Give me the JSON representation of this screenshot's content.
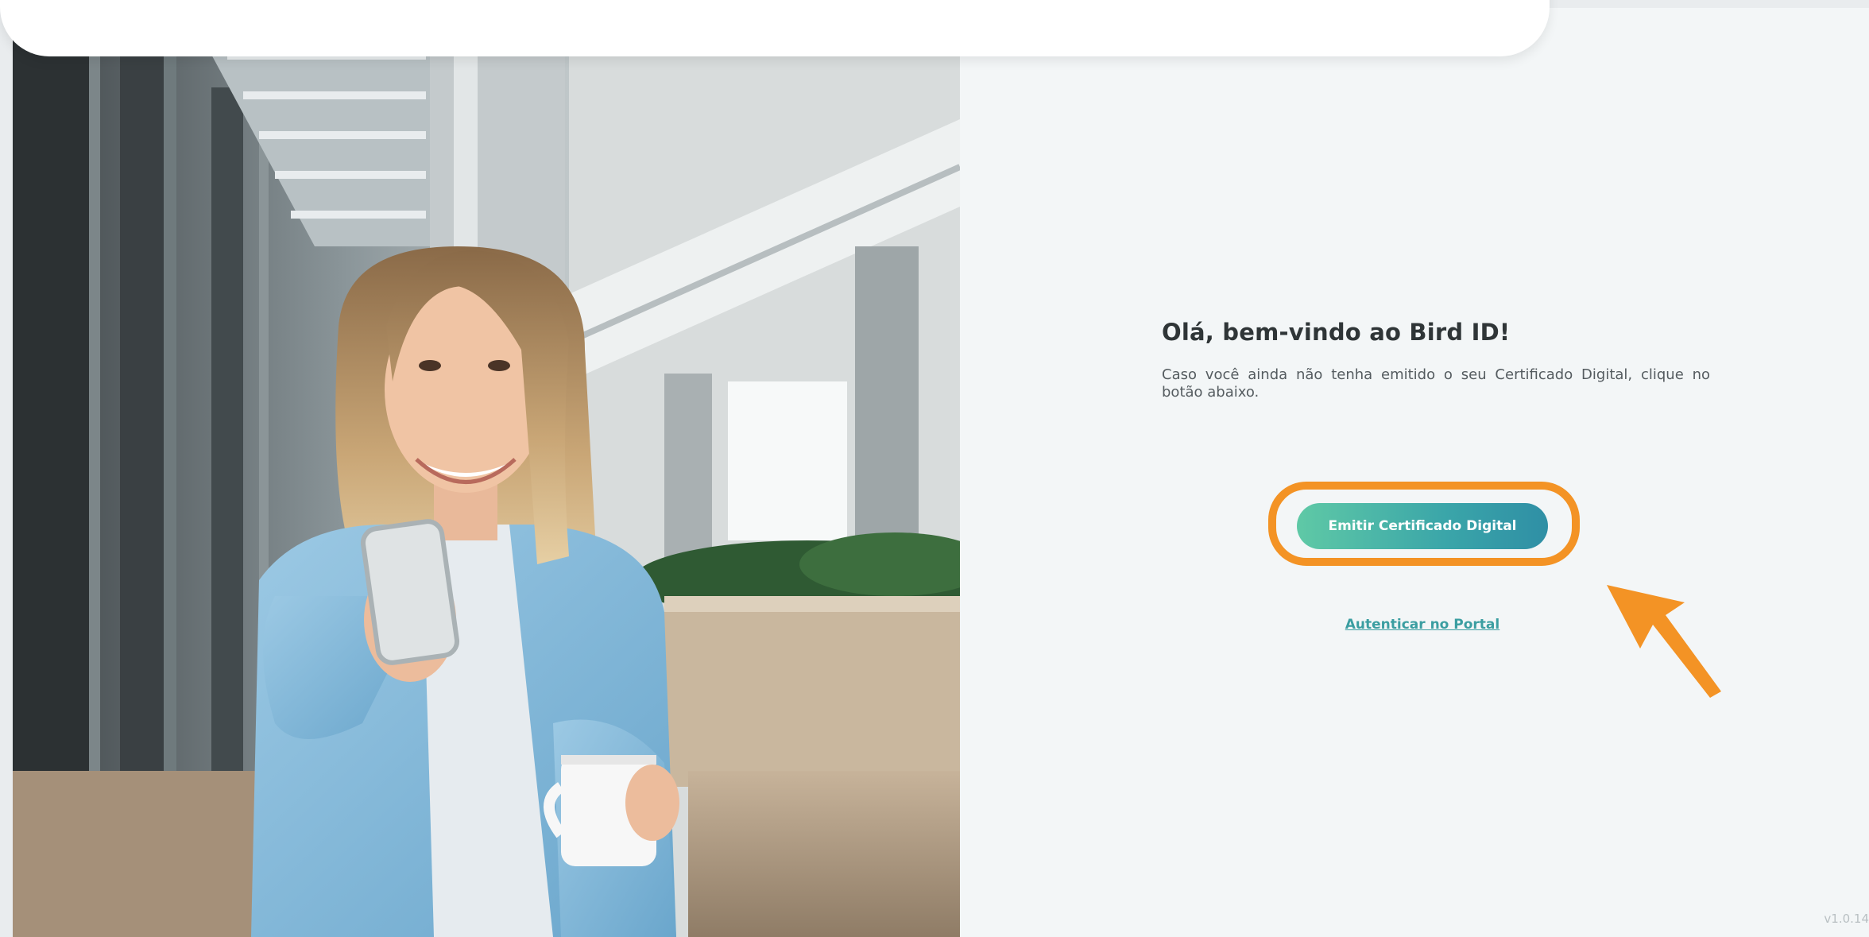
{
  "welcome": {
    "title": "Olá, bem-vindo ao Bird ID!",
    "description": "Caso você ainda não tenha emitido o seu Certificado Digital, clique no botão abaixo."
  },
  "actions": {
    "issue_certificate_label": "Emitir Certificado Digital",
    "portal_link_label": "Autenticar no Portal"
  },
  "footer": {
    "version": "v1.0.14"
  },
  "annotation": {
    "highlight_color": "#f39325"
  },
  "colors": {
    "button_gradient_start": "#5fc9a6",
    "button_gradient_end": "#2f8fa5",
    "link": "#3b9ea1",
    "panel_background": "#f3f6f7"
  }
}
